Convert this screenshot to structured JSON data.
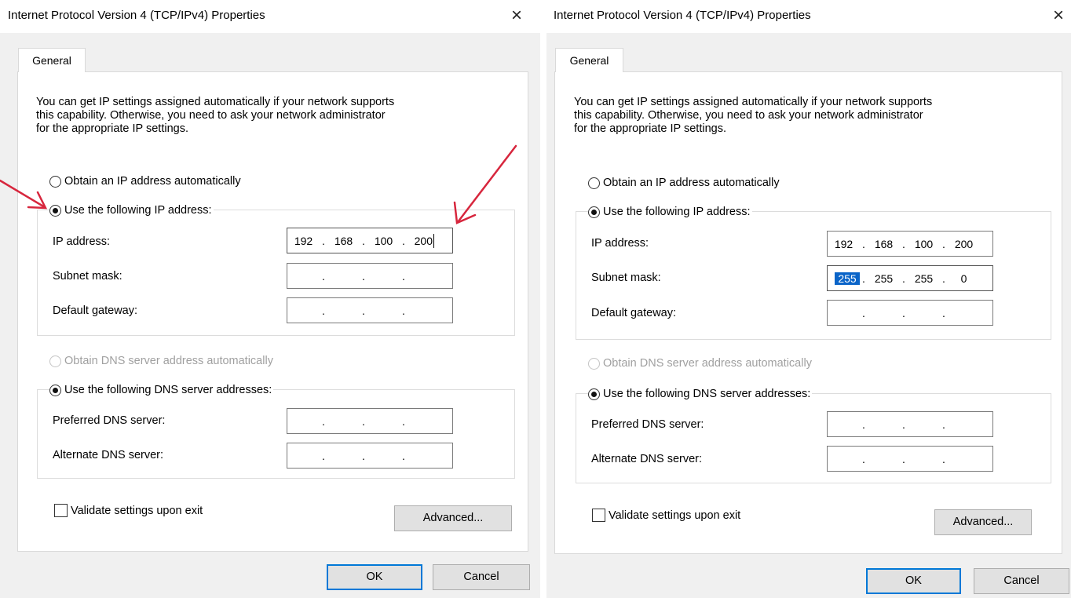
{
  "dialogs": [
    {
      "title": "Internet Protocol Version 4 (TCP/IPv4) Properties",
      "close_glyph": "×",
      "tab_label": "General",
      "description_lines": [
        "You can get IP settings assigned automatically if your network supports",
        "this capability. Otherwise, you need to ask your network administrator",
        "for the appropriate IP settings."
      ],
      "ip_auto_label": "Obtain an IP address automatically",
      "ip_manual_label": "Use the following IP address:",
      "ip_label": "IP address:",
      "ip_value": [
        "192",
        "168",
        "100",
        "200"
      ],
      "subnet_label": "Subnet mask:",
      "subnet_value": [
        "",
        "",
        "",
        ""
      ],
      "gateway_label": "Default gateway:",
      "gateway_value": [
        "",
        "",
        "",
        ""
      ],
      "dns_auto_label": "Obtain DNS server address automatically",
      "dns_manual_label": "Use the following DNS server addresses:",
      "preferred_dns_label": "Preferred DNS server:",
      "preferred_dns_value": [
        "",
        "",
        "",
        ""
      ],
      "alternate_dns_label": "Alternate DNS server:",
      "alternate_dns_value": [
        "",
        "",
        "",
        ""
      ],
      "validate_label": "Validate settings upon exit",
      "advanced_label": "Advanced...",
      "ok_label": "OK",
      "cancel_label": "Cancel"
    },
    {
      "title": "Internet Protocol Version 4 (TCP/IPv4) Properties",
      "close_glyph": "×",
      "tab_label": "General",
      "description_lines": [
        "You can get IP settings assigned automatically if your network supports",
        "this capability. Otherwise, you need to ask your network administrator",
        "for the appropriate IP settings."
      ],
      "ip_auto_label": "Obtain an IP address automatically",
      "ip_manual_label": "Use the following IP address:",
      "ip_label": "IP address:",
      "ip_value": [
        "192",
        "168",
        "100",
        "200"
      ],
      "subnet_label": "Subnet mask:",
      "subnet_value": [
        "255",
        "255",
        "255",
        "0"
      ],
      "gateway_label": "Default gateway:",
      "gateway_value": [
        "",
        "",
        "",
        ""
      ],
      "dns_auto_label": "Obtain DNS server address automatically",
      "dns_manual_label": "Use the following DNS server addresses:",
      "preferred_dns_label": "Preferred DNS server:",
      "preferred_dns_value": [
        "",
        "",
        "",
        ""
      ],
      "alternate_dns_label": "Alternate DNS server:",
      "alternate_dns_value": [
        "",
        "",
        "",
        ""
      ],
      "validate_label": "Validate settings upon exit",
      "advanced_label": "Advanced...",
      "ok_label": "OK",
      "cancel_label": "Cancel"
    }
  ],
  "colors": {
    "annotation_arrow": "#d7263d",
    "selection": "#0a64c8",
    "default_button_border": "#0078d7"
  }
}
